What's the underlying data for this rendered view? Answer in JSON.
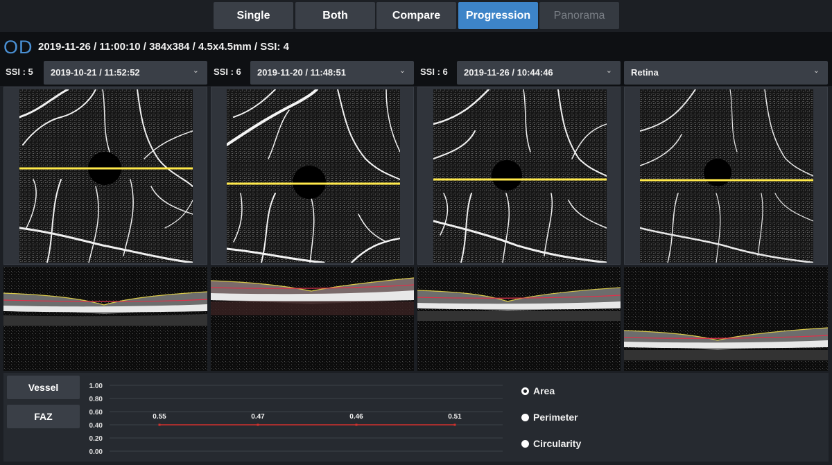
{
  "modes": [
    {
      "label": "Single",
      "state": "normal"
    },
    {
      "label": "Both",
      "state": "normal"
    },
    {
      "label": "Compare",
      "state": "normal"
    },
    {
      "label": "Progression",
      "state": "active"
    },
    {
      "label": "Panorama",
      "state": "disabled"
    }
  ],
  "eye": "OD",
  "scan_info": "2019-11-26 / 11:00:10 / 384x384 / 4.5x4.5mm / SSI: 4",
  "columns": [
    {
      "ssi_label": "SSI :",
      "ssi_value": "5",
      "date": "2019-10-21 / 11:52:52"
    },
    {
      "ssi_label": "SSI :",
      "ssi_value": "6",
      "date": "2019-11-20 / 11:48:51"
    },
    {
      "ssi_label": "SSI :",
      "ssi_value": "6",
      "date": "2019-11-26 / 10:44:46"
    }
  ],
  "layer_select": "Retina",
  "side_buttons": {
    "vessel": "Vessel",
    "faz": "FAZ"
  },
  "metrics": [
    {
      "label": "Area",
      "selected": true
    },
    {
      "label": "Perimeter",
      "selected": false
    },
    {
      "label": "Circularity",
      "selected": false
    }
  ],
  "colors": {
    "accent": "#3d84c8",
    "scan_line": "#ffe94a",
    "trend_line": "#d0312d"
  },
  "chart_data": {
    "type": "line",
    "yticks": [
      "1.00",
      "0.80",
      "0.60",
      "0.40",
      "0.20",
      "0.00"
    ],
    "ylim": [
      0,
      1
    ],
    "x": [
      1,
      2,
      3,
      4
    ],
    "values": [
      0.55,
      0.47,
      0.46,
      0.51
    ],
    "value_labels": [
      "0.55",
      "0.47",
      "0.46",
      "0.51"
    ],
    "plotted_level": 0.4,
    "grid": true
  }
}
